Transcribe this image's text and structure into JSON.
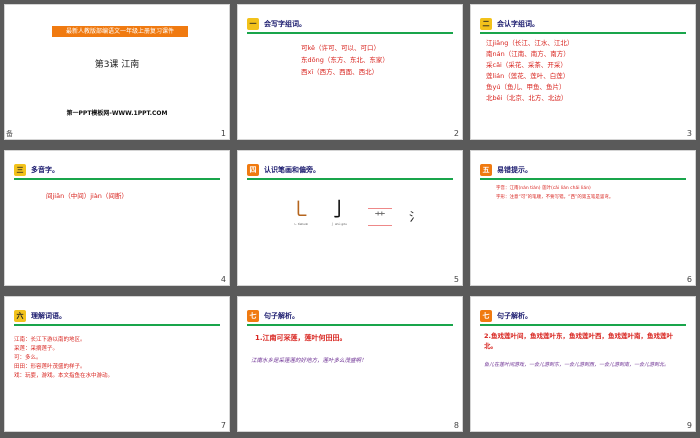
{
  "slides": [
    {
      "num": "1",
      "banner": "最新人教版部编语文一年级上册复习课件",
      "title": "第3课  江南",
      "footer": "第一PPT模板网-WWW.1PPT.COM",
      "corner": "备"
    },
    {
      "num": "2",
      "badge": "一",
      "heading": "会写字组词。",
      "lines": [
        "可kě（许可、可以、可口）",
        "东dōng（东方、东北、东家）",
        "西xī（西方、西面、西北）"
      ]
    },
    {
      "num": "3",
      "badge": "二",
      "heading": "会认字组词。",
      "lines": [
        "江jiāng（长江、江水、江北）",
        "南nán（江南、南方、南方）",
        "采cǎi（采花、采茶、开采）",
        "莲lián（莲花、莲叶、白莲）",
        "鱼yú（鱼儿、甲鱼、鱼片）",
        "北běi（北京、北方、北边）"
      ]
    },
    {
      "num": "4",
      "badge": "三",
      "heading": "多音字。",
      "lines": [
        "间jiān（中间）jiàn（间断）"
      ]
    },
    {
      "num": "5",
      "badge": "四",
      "heading": "认识笔画和偏旁。",
      "strokes": [
        {
          "glyph": "㇄",
          "cap": "ㄴ tíshuāi"
        },
        {
          "glyph": "亅",
          "cap": "亅 shù gōu"
        },
        {
          "glyph": "艹",
          "cap": ""
        },
        {
          "glyph": "氵",
          "cap": ""
        }
      ]
    },
    {
      "num": "6",
      "badge": "五",
      "heading": "易错提示。",
      "lines": [
        "字音：江南(nán tián) 莲叶(cǎi lián chǎi lián)",
        "字形：注意“可”的笔顺，不要写错。“西”的第五笔是竖弯。"
      ]
    },
    {
      "num": "7",
      "badge": "六",
      "heading": "理解词语。",
      "lines": [
        "江南：长江下游以南的地区。",
        "采莲：采摘莲子。",
        "可：多么。",
        "田田：形容莲叶茂盛的样子。",
        "戏：玩耍，游戏。本文指鱼在水中游动。"
      ]
    },
    {
      "num": "8",
      "badge": "七",
      "heading": "句子解析。",
      "sentence": "1.江南可采莲，莲叶何田田。",
      "explain": "江南水乡是采莲莲的好地方，莲叶多么茂盛啊！"
    },
    {
      "num": "9",
      "badge": "七",
      "heading": "句子解析。",
      "sentence": "2.鱼戏莲叶间，鱼戏莲叶东，鱼戏莲叶西，鱼戏莲叶南，鱼戏莲叶北。",
      "explain": "鱼儿在莲叶间游戏，一会儿游到东，一会儿游到西，一会儿游到南，一会儿游到北。"
    }
  ]
}
